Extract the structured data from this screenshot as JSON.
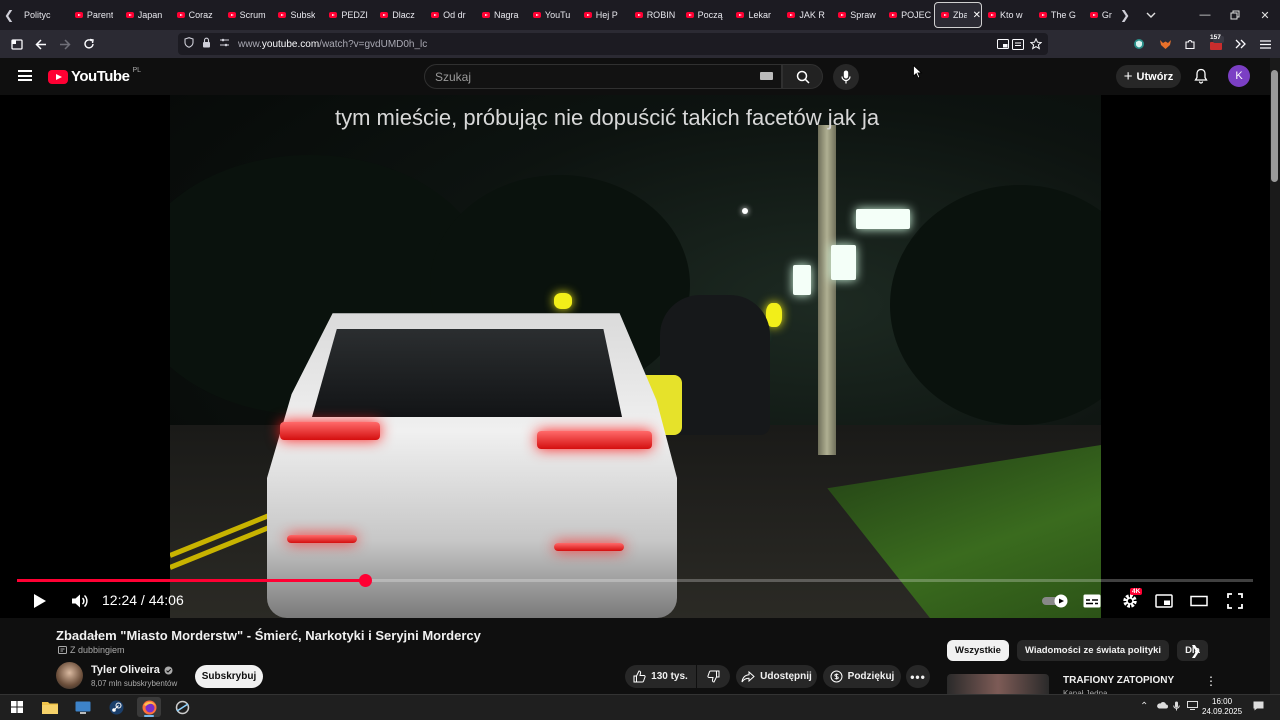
{
  "browser": {
    "tabs": [
      {
        "label": "Polityc",
        "favicon": "none"
      },
      {
        "label": "Parent",
        "favicon": "youtube"
      },
      {
        "label": "Japan",
        "favicon": "youtube"
      },
      {
        "label": "Coraz",
        "favicon": "youtube"
      },
      {
        "label": "Scrum",
        "favicon": "youtube"
      },
      {
        "label": "Subsk",
        "favicon": "youtube"
      },
      {
        "label": "PEDZI",
        "favicon": "youtube"
      },
      {
        "label": "Dlacz",
        "favicon": "youtube"
      },
      {
        "label": "Od dr",
        "favicon": "youtube"
      },
      {
        "label": "Nagra",
        "favicon": "youtube"
      },
      {
        "label": "YouTu",
        "favicon": "youtube"
      },
      {
        "label": "Hej P",
        "favicon": "youtube"
      },
      {
        "label": "ROBIN",
        "favicon": "youtube"
      },
      {
        "label": "Począ",
        "favicon": "youtube"
      },
      {
        "label": "Lekar",
        "favicon": "youtube"
      },
      {
        "label": "JAK R",
        "favicon": "youtube"
      },
      {
        "label": "Spraw",
        "favicon": "youtube"
      },
      {
        "label": "POJEC",
        "favicon": "youtube"
      },
      {
        "label": "Zba",
        "favicon": "youtube",
        "active": true
      },
      {
        "label": "Kto w",
        "favicon": "youtube"
      },
      {
        "label": "The G",
        "favicon": "youtube"
      },
      {
        "label": "Gr",
        "favicon": "youtube"
      }
    ],
    "url_prefix": "www.",
    "url_host": "youtube.com",
    "url_path": "/watch?v=gvdUMD0h_lc",
    "extensions_badge": "157"
  },
  "header": {
    "logo_text": "YouTube",
    "region": "PL",
    "search_placeholder": "Szukaj",
    "create_label": "Utwórz",
    "avatar_letter": "K"
  },
  "player": {
    "subtitle": "tym mieście, próbując nie dopuścić takich facetów jak ja",
    "time_current": "12:24",
    "time_total": "44:06",
    "progress": 0.2812,
    "quality_badge": "4K"
  },
  "video": {
    "title": "Zbadałem \"Miasto Morderstw\" - Śmierć, Narkotyki i Seryjni Mordercy",
    "dub_label": "Z dubbingiem",
    "channel_name": "Tyler Oliveira",
    "subscribers": "8,07 mln subskrybentów",
    "subscribe_label": "Subskrybuj",
    "likes": "130 tys.",
    "share_label": "Udostępnij",
    "thanks_label": "Podziękuj"
  },
  "sidebar": {
    "chips": [
      {
        "label": "Wszystkie",
        "active": true
      },
      {
        "label": "Wiadomości ze świata polityki",
        "active": false
      },
      {
        "label": "Dla",
        "active": false
      }
    ],
    "rec_title": "TRAFIONY ZATOPIONY",
    "rec_channel": "Kanał Jedna"
  },
  "taskbar": {
    "time": "16:00",
    "date": "24.09.2025"
  },
  "colors": {
    "brand_red": "#ff0033",
    "avatar_purple": "#7b3fc4",
    "background": "#0f0f0f"
  }
}
